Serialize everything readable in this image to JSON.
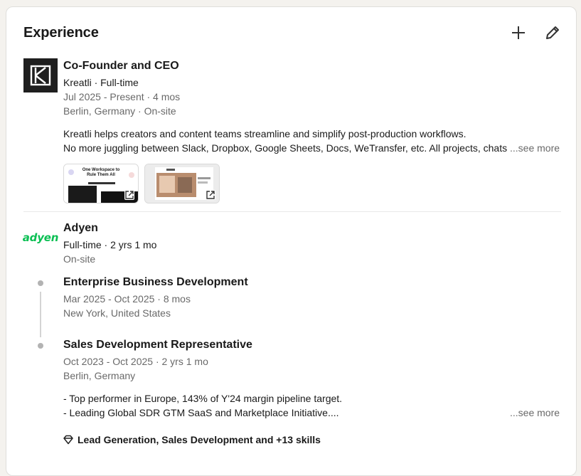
{
  "section": {
    "title": "Experience",
    "add_icon": "plus-icon",
    "edit_icon": "pencil-icon"
  },
  "kreatli": {
    "logo_icon": "kreatli-logo",
    "role": "Co-Founder and CEO",
    "company_line": "Kreatli · Full-time",
    "dates": "Jul 2025 - Present · 4 mos",
    "location": "Berlin, Germany · On-site",
    "desc_line1": "Kreatli helps creators and content teams streamline and simplify post-production workflows.",
    "desc_line2": "No more juggling between Slack, Dropbox, Google Sheets, Docs, WeTransfer, etc. All projects, chats, files",
    "see_more": "...see more",
    "media": [
      {
        "heading": "One Workspace to Rule Them All",
        "icon": "external-link-icon"
      },
      {
        "heading": "",
        "icon": "external-link-icon"
      }
    ]
  },
  "adyen": {
    "logo_text": "adyen",
    "company": "Adyen",
    "employment": "Full-time · 2 yrs 1 mo",
    "workplace": "On-site",
    "roles": [
      {
        "title": "Enterprise Business Development",
        "dates": "Mar 2025 - Oct 2025 · 8 mos",
        "location": "New York, United States"
      },
      {
        "title": "Sales Development Representative",
        "dates": "Oct 2023 - Oct 2025 · 2 yrs 1 mo",
        "location": "Berlin, Germany",
        "desc_line1": "- Top performer in Europe, 143% of Y'24 margin pipeline target.",
        "desc_line2": "- Leading Global SDR GTM SaaS and Marketplace Initiative....",
        "see_more": "...see more",
        "skills": "Lead Generation, Sales Development and +13 skills",
        "skills_icon": "diamond-icon"
      }
    ]
  },
  "colors": {
    "adyen_green": "#0abf53",
    "kreatli_bg": "#1f1f1f",
    "page_bg": "#f4f2ee"
  }
}
